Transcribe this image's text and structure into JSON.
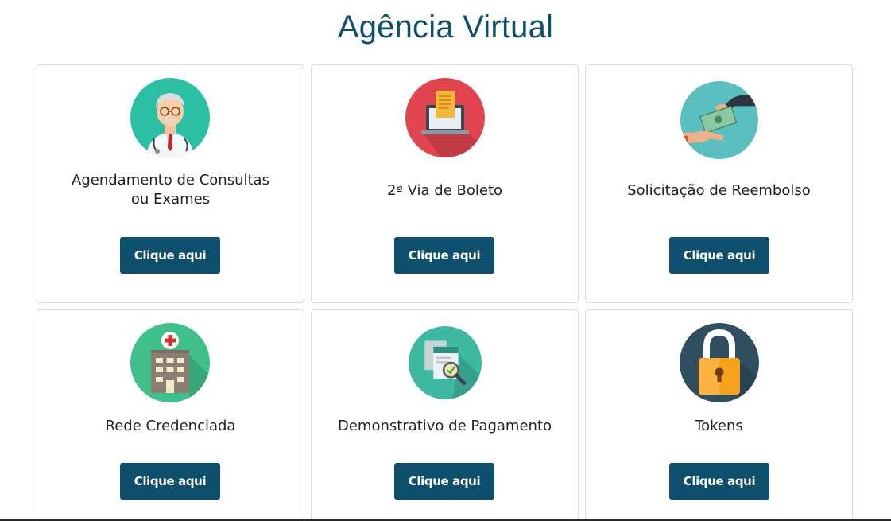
{
  "page": {
    "title": "Agência Virtual"
  },
  "cards": [
    {
      "label_line1": "Agendamento de Consultas",
      "label_line2": "ou Exames",
      "button": "Clique aqui",
      "icon": "doctor-icon",
      "icon_color": "#2bbfa4"
    },
    {
      "label_line1": "2ª Via de Boleto",
      "label_line2": "",
      "button": "Clique aqui",
      "icon": "laptop-document-icon",
      "icon_color": "#e0444e"
    },
    {
      "label_line1": "Solicitação de Reembolso",
      "label_line2": "",
      "button": "Clique aqui",
      "icon": "money-exchange-icon",
      "icon_color": "#5bbfbf"
    },
    {
      "label_line1": "Rede Credenciada",
      "label_line2": "",
      "button": "Clique aqui",
      "icon": "hospital-icon",
      "icon_color": "#3fbf8a"
    },
    {
      "label_line1": "Demonstrativo de Pagamento",
      "label_line2": "",
      "button": "Clique aqui",
      "icon": "payment-report-icon",
      "icon_color": "#3eb8a0"
    },
    {
      "label_line1": "Tokens",
      "label_line2": "",
      "button": "Clique aqui",
      "icon": "padlock-icon",
      "icon_color": "#2f4f60"
    }
  ],
  "colors": {
    "brand": "#0f4f6b",
    "button_bg": "#0d4f6c",
    "button_text": "#ffffff"
  }
}
